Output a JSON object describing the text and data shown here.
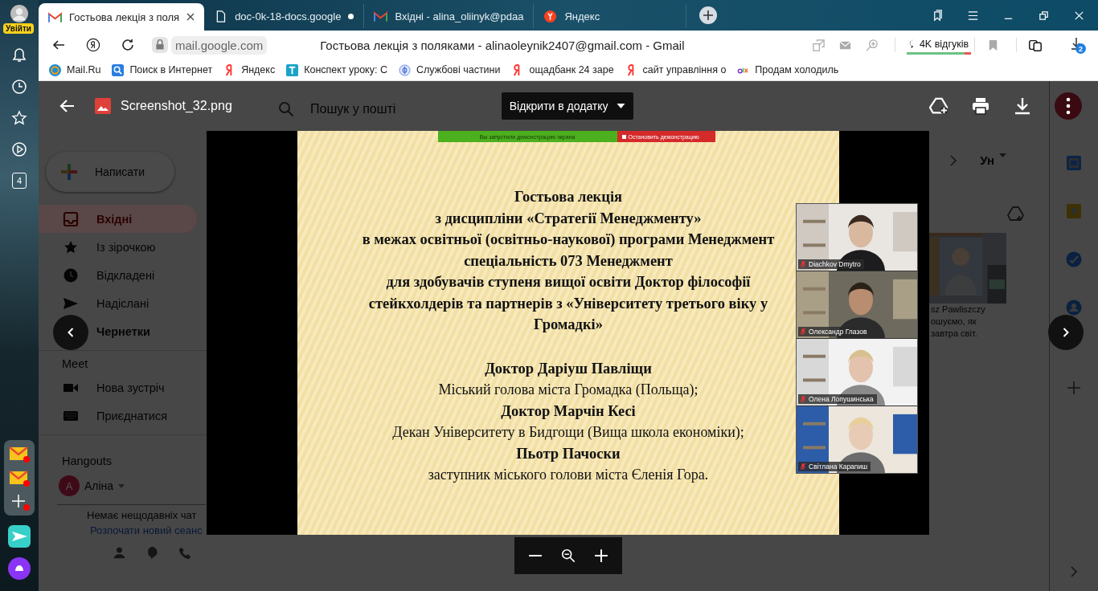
{
  "yandex_sidebar": {
    "login_badge": "Увійти",
    "tab_count": "4"
  },
  "tabs": [
    {
      "title": "Гостьова лекція з поля",
      "selected": true,
      "kind": "gmail"
    },
    {
      "title": "doc-0k-18-docs.google",
      "selected": false,
      "kind": "doc"
    },
    {
      "title": "Вхідні - alina_oliinyk@pdaa",
      "selected": false,
      "kind": "gmail"
    },
    {
      "title": "Яндекс",
      "selected": false,
      "kind": "yandex"
    }
  ],
  "address_bar": {
    "domain": "mail.google.com",
    "page_title": "Гостьова лекція з поляками - alinaoleynik2407@gmail.com - Gmail",
    "reviews": "4K відгуків",
    "downloads_badge": "2"
  },
  "bookmarks": [
    {
      "label": "Mail.Ru",
      "kind": "mailru"
    },
    {
      "label": "Поиск в Интернет",
      "kind": "search"
    },
    {
      "label": "Яндекс",
      "kind": "ya"
    },
    {
      "label": "Конспект уроку: С",
      "kind": "t"
    },
    {
      "label": "Службові частини",
      "kind": "shield"
    },
    {
      "label": "ощадбанк 24 заре",
      "kind": "ya"
    },
    {
      "label": "сайт управління о",
      "kind": "ya"
    },
    {
      "label": "Продам холодиль",
      "kind": "olx"
    }
  ],
  "gmail": {
    "search_placeholder": "Пошук у пошті",
    "compose": "Написати",
    "nav": [
      {
        "label": "Вхідні",
        "selected": true,
        "kind": "inbox"
      },
      {
        "label": "Із зірочкою",
        "selected": false,
        "kind": "star"
      },
      {
        "label": "Відкладені",
        "selected": false,
        "kind": "clock"
      },
      {
        "label": "Надіслані",
        "selected": false,
        "kind": "send"
      },
      {
        "label": "Чернетки",
        "selected": false,
        "kind": "draft"
      }
    ],
    "meet_heading": "Meet",
    "meet": [
      {
        "label": "Нова зустріч",
        "kind": "video"
      },
      {
        "label": "Приєднатися",
        "kind": "keyboard"
      }
    ],
    "hangouts_heading": "Hangouts",
    "avatar": "A",
    "user": "Аліна",
    "no_chats": "Немає нещодавніх чат",
    "start_chat": "Розпочати новий сеанс",
    "sort": "Ун",
    "preview_lines": [
      "sz Pawliszczy",
      "ошуємо, як",
      "завтра світ."
    ]
  },
  "viewer": {
    "filename": "Screenshot_32.png",
    "open_with": "Відкрити в додатку"
  },
  "slide": {
    "share_notice": "Вы запустили демонстрацию экрана",
    "stop_share": "Остановить демонстрацию",
    "lines": [
      {
        "text": "Гостьова лекція",
        "bold": true
      },
      {
        "text": "з дисципліни «Стратегії Менеджменту»",
        "bold": true
      },
      {
        "text": "в межах освітньої (освітньо-наукової)  програми Менеджмент",
        "bold": true
      },
      {
        "text": "спеціальність 073 Менеджмент",
        "bold": true
      },
      {
        "text": "для здобувачів  ступеня вищої освіти Доктор філософії",
        "bold": true
      },
      {
        "text": "стейкхолдерів та партнерів з «Університету третього віку у",
        "bold": true
      },
      {
        "text": "Громадкі»",
        "bold": true
      }
    ],
    "guests": [
      {
        "text": "Доктор Даріуш Павліщи",
        "bold": true
      },
      {
        "text": "Міський голова міста Громадка (Польща);",
        "bold": false
      },
      {
        "text": "Доктор Марчін Кесі",
        "bold": true
      },
      {
        "text": "Декан Університету в Бидгощи (Вища школа економіки);",
        "bold": false
      },
      {
        "text": "Пьотр Пачоски",
        "bold": true
      },
      {
        "text": "заступник міського голови міста Єленія Гора.",
        "bold": false
      }
    ]
  },
  "participants": [
    {
      "name": "Diachkov Dmytro",
      "muted": true
    },
    {
      "name": "Олександр Глазов",
      "muted": true
    },
    {
      "name": "Олена Лопушинська",
      "muted": true
    },
    {
      "name": "Світлана Карапиш",
      "muted": true
    }
  ]
}
